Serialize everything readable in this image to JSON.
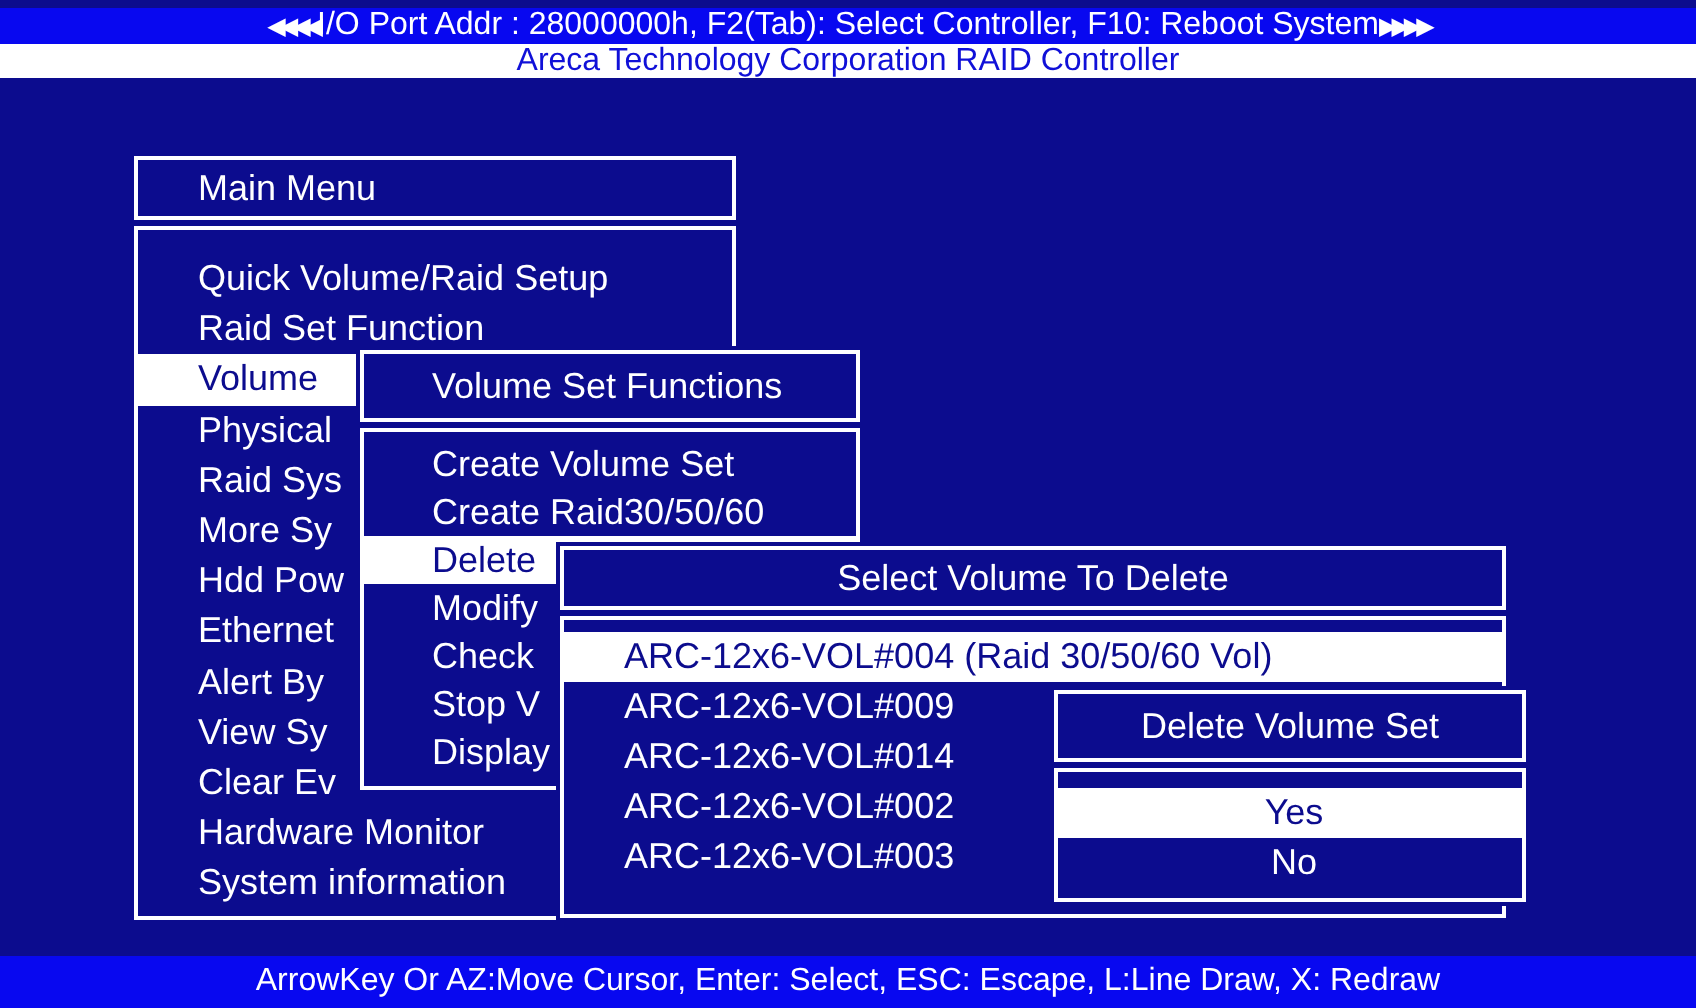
{
  "header": {
    "left_arrows": "◀◀◀◀",
    "text": "I/O Port Addr : 28000000h, F2(Tab): Select Controller, F10: Reboot System",
    "right_arrows": "▶▶▶▶",
    "subtitle": "Areca Technology Corporation RAID Controller"
  },
  "main_menu": {
    "title": "Main Menu",
    "items": [
      {
        "label": "Quick Volume/Raid Setup",
        "selected": false
      },
      {
        "label": "Raid Set Function",
        "selected": false
      },
      {
        "label": "Volume",
        "selected": true
      },
      {
        "label": "Physical",
        "selected": false
      },
      {
        "label": "Raid Sys",
        "selected": false
      },
      {
        "label": "More Sy",
        "selected": false
      },
      {
        "label": "Hdd Pow",
        "selected": false
      },
      {
        "label": "Ethernet",
        "selected": false
      },
      {
        "label": "Alert By",
        "selected": false
      },
      {
        "label": "View Sy",
        "selected": false
      },
      {
        "label": "Clear Ev",
        "selected": false
      },
      {
        "label": "Hardware Monitor",
        "selected": false
      },
      {
        "label": "System information",
        "selected": false
      }
    ]
  },
  "volume_set_functions": {
    "title": "Volume Set Functions",
    "items": [
      {
        "label": "Create Volume Set",
        "selected": false
      },
      {
        "label": "Create Raid30/50/60",
        "selected": false
      },
      {
        "label": "Delete",
        "selected": true
      },
      {
        "label": "Modify",
        "selected": false
      },
      {
        "label": "Check",
        "selected": false
      },
      {
        "label": "Stop V",
        "selected": false
      },
      {
        "label": "Display",
        "selected": false
      }
    ]
  },
  "select_volume": {
    "title": "Select Volume To Delete",
    "items": [
      {
        "label": "ARC-12x6-VOL#004 (Raid 30/50/60 Vol)",
        "selected": true
      },
      {
        "label": "ARC-12x6-VOL#009",
        "selected": false
      },
      {
        "label": "ARC-12x6-VOL#014",
        "selected": false
      },
      {
        "label": "ARC-12x6-VOL#002",
        "selected": false
      },
      {
        "label": "ARC-12x6-VOL#003",
        "selected": false
      }
    ]
  },
  "delete_confirm": {
    "title": "Delete Volume Set",
    "items": [
      {
        "label": "Yes",
        "selected": true
      },
      {
        "label": "No",
        "selected": false
      }
    ]
  },
  "status_bar": "ArrowKey Or AZ:Move Cursor, Enter: Select, ESC: Escape, L:Line Draw, X: Redraw"
}
